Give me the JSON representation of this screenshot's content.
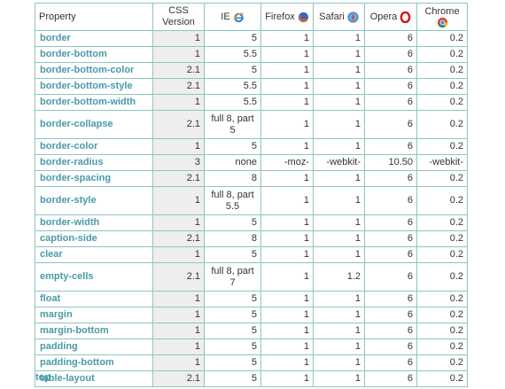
{
  "header": {
    "property": "Property",
    "css": "CSS Version",
    "ie": "IE",
    "firefox": "Firefox",
    "safari": "Safari",
    "opera": "Opera",
    "chrome": "Chrome"
  },
  "icons": {
    "ie": "ie-logo-icon",
    "firefox": "firefox-logo-icon",
    "safari": "safari-logo-icon",
    "opera": "opera-logo-icon",
    "chrome": "chrome-logo-icon"
  },
  "colors": {
    "link": "#4a9aa8",
    "border": "#8fc4c4",
    "css_column_bg": "#eeeeee"
  },
  "rows": [
    {
      "property": "border",
      "css": "1",
      "ie": "5",
      "firefox": "1",
      "safari": "1",
      "opera": "6",
      "chrome": "0.2"
    },
    {
      "property": "border-bottom",
      "css": "1",
      "ie": "5.5",
      "firefox": "1",
      "safari": "1",
      "opera": "6",
      "chrome": "0.2"
    },
    {
      "property": "border-bottom-color",
      "css": "2.1",
      "ie": "5",
      "firefox": "1",
      "safari": "1",
      "opera": "6",
      "chrome": "0.2"
    },
    {
      "property": "border-bottom-style",
      "css": "2.1",
      "ie": "5.5",
      "firefox": "1",
      "safari": "1",
      "opera": "6",
      "chrome": "0.2"
    },
    {
      "property": "border-bottom-width",
      "css": "1",
      "ie": "5.5",
      "firefox": "1",
      "safari": "1",
      "opera": "6",
      "chrome": "0.2"
    },
    {
      "property": "border-collapse",
      "css": "2.1",
      "ie": "full 8, part 5",
      "firefox": "1",
      "safari": "1",
      "opera": "6",
      "chrome": "0.2"
    },
    {
      "property": "border-color",
      "css": "1",
      "ie": "5",
      "firefox": "1",
      "safari": "1",
      "opera": "6",
      "chrome": "0.2"
    },
    {
      "property": "border-radius",
      "css": "3",
      "ie": "none",
      "firefox": "-moz-",
      "safari": "-webkit-",
      "opera": "10.50",
      "chrome": "-webkit-"
    },
    {
      "property": "border-spacing",
      "css": "2.1",
      "ie": "8",
      "firefox": "1",
      "safari": "1",
      "opera": "6",
      "chrome": "0.2"
    },
    {
      "property": "border-style",
      "css": "1",
      "ie": "full 8, part 5.5",
      "firefox": "1",
      "safari": "1",
      "opera": "6",
      "chrome": "0.2"
    },
    {
      "property": "border-width",
      "css": "1",
      "ie": "5",
      "firefox": "1",
      "safari": "1",
      "opera": "6",
      "chrome": "0.2"
    },
    {
      "property": "caption-side",
      "css": "2.1",
      "ie": "8",
      "firefox": "1",
      "safari": "1",
      "opera": "6",
      "chrome": "0.2"
    },
    {
      "property": "clear",
      "css": "1",
      "ie": "5",
      "firefox": "1",
      "safari": "1",
      "opera": "6",
      "chrome": "0.2"
    },
    {
      "property": "empty-cells",
      "css": "2.1",
      "ie": "full 8, part 7",
      "firefox": "1",
      "safari": "1.2",
      "opera": "6",
      "chrome": "0.2"
    },
    {
      "property": "float",
      "css": "1",
      "ie": "5",
      "firefox": "1",
      "safari": "1",
      "opera": "6",
      "chrome": "0.2"
    },
    {
      "property": "margin",
      "css": "1",
      "ie": "5",
      "firefox": "1",
      "safari": "1",
      "opera": "6",
      "chrome": "0.2"
    },
    {
      "property": "margin-bottom",
      "css": "1",
      "ie": "5",
      "firefox": "1",
      "safari": "1",
      "opera": "6",
      "chrome": "0.2"
    },
    {
      "property": "padding",
      "css": "1",
      "ie": "5",
      "firefox": "1",
      "safari": "1",
      "opera": "6",
      "chrome": "0.2"
    },
    {
      "property": "padding-bottom",
      "css": "1",
      "ie": "5",
      "firefox": "1",
      "safari": "1",
      "opera": "6",
      "chrome": "0.2"
    },
    {
      "property": "table-layout",
      "css": "2.1",
      "ie": "5",
      "firefox": "1",
      "safari": "1",
      "opera": "6",
      "chrome": "0.2"
    }
  ],
  "footer": {
    "top_link": "top"
  }
}
